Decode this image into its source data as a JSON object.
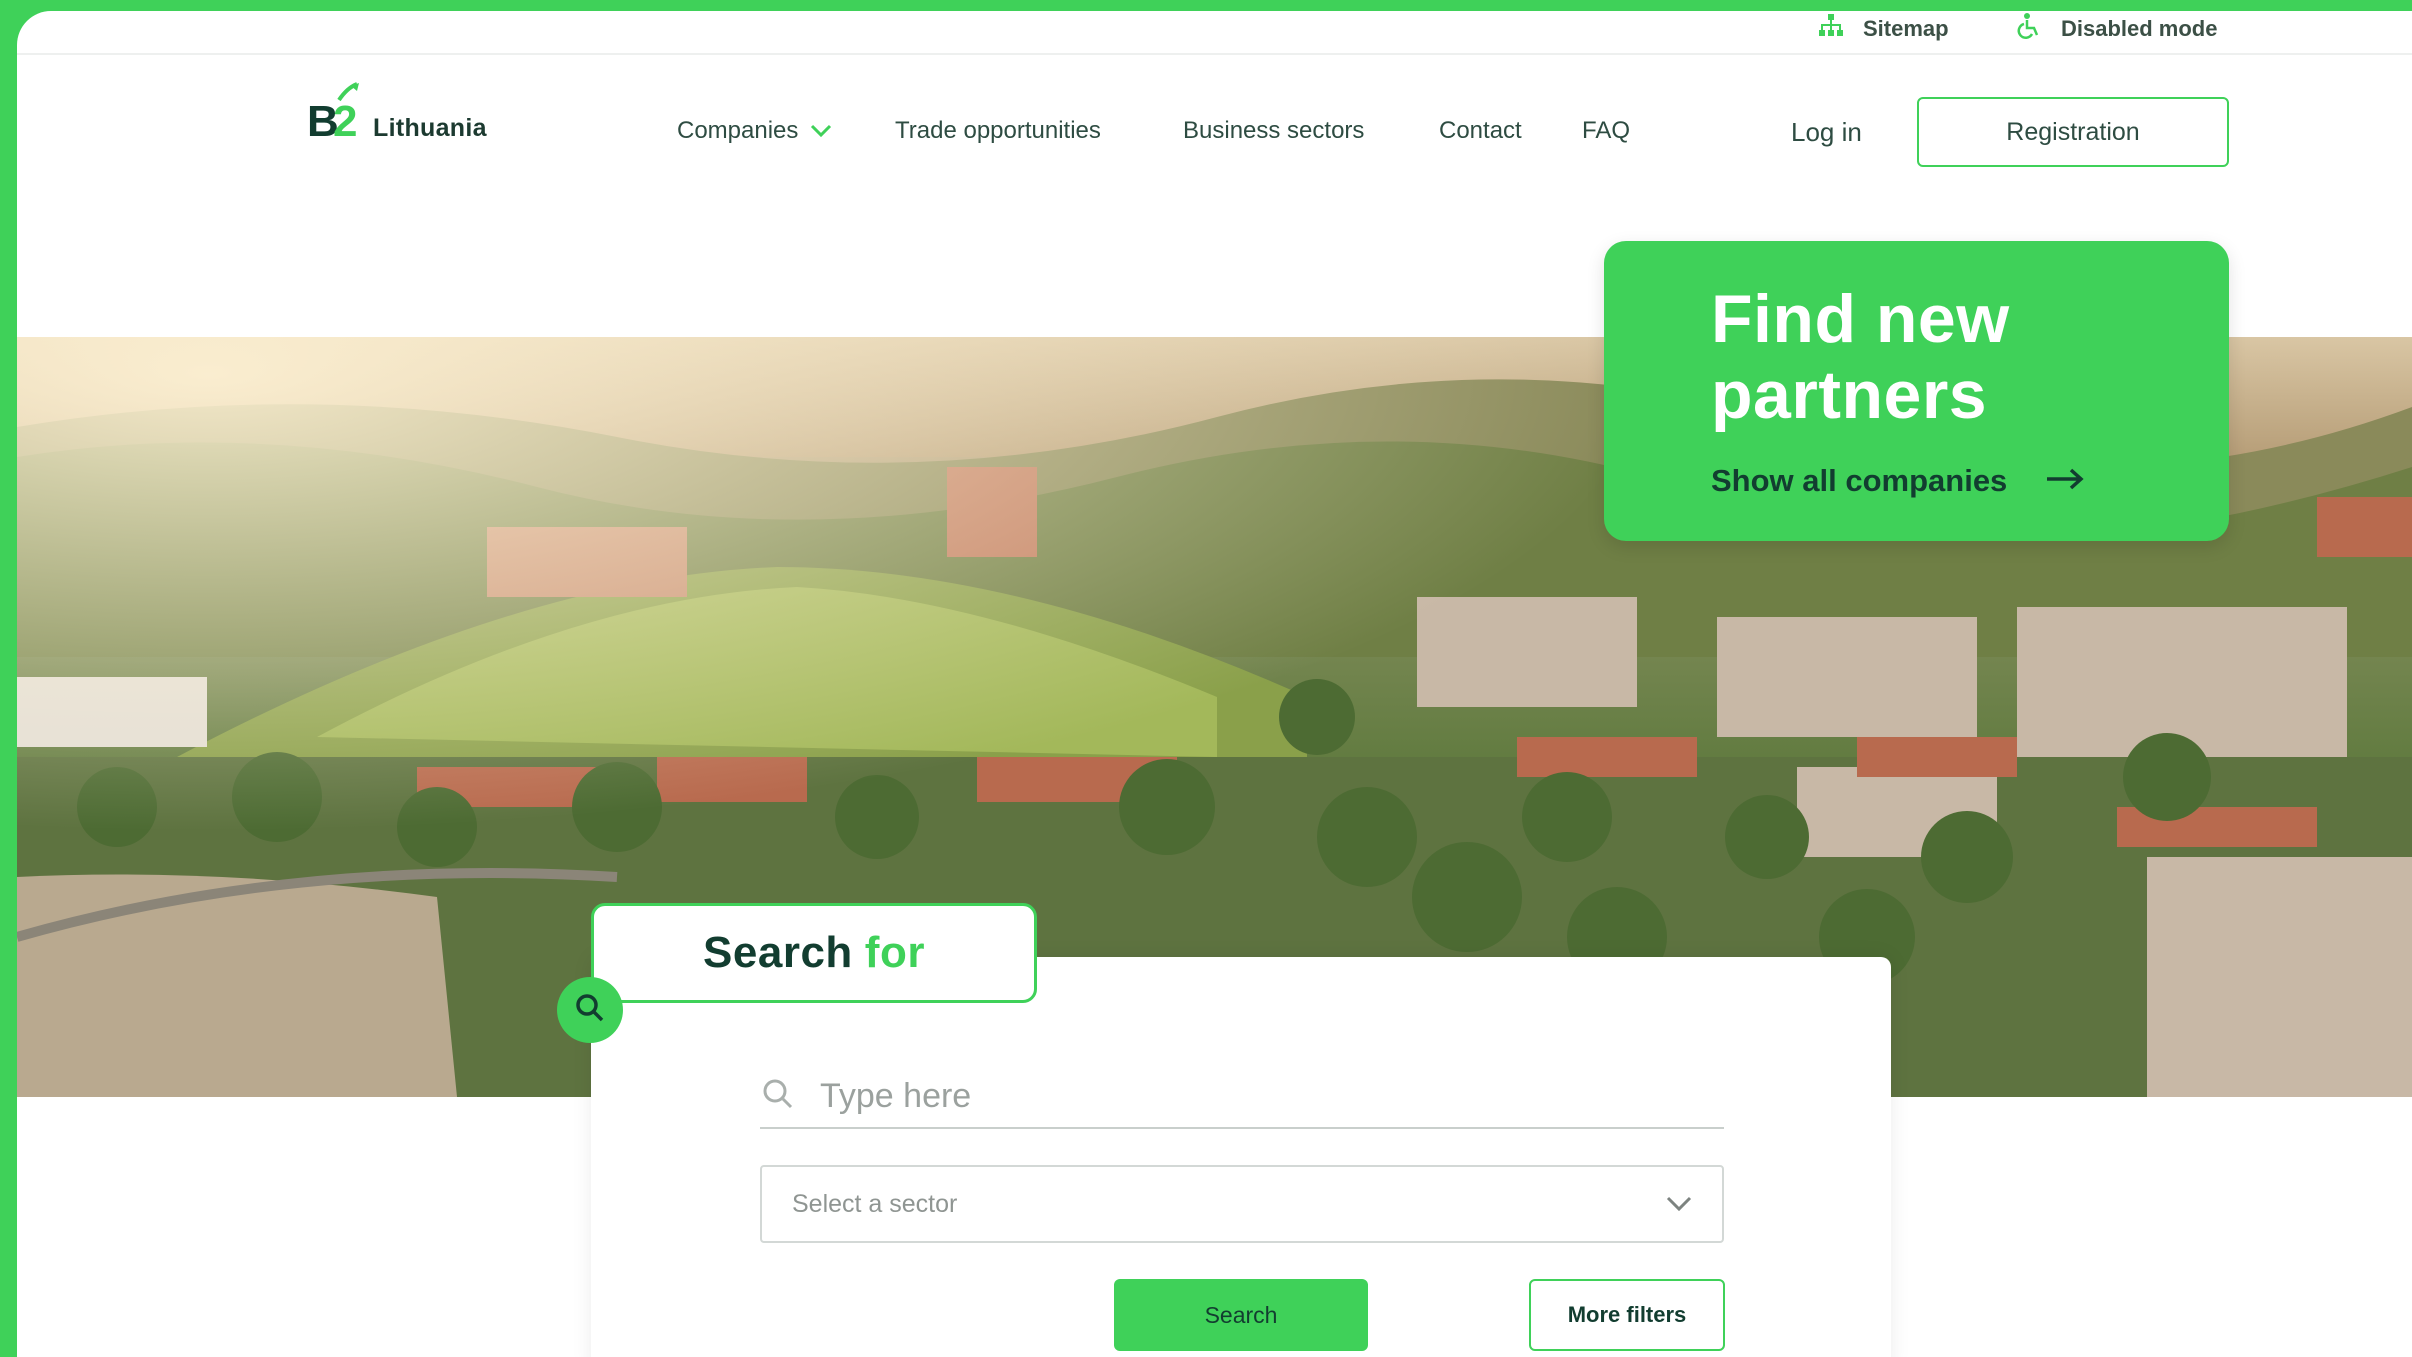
{
  "utility": {
    "sitemap": "Sitemap",
    "disabled_mode": "Disabled mode"
  },
  "logo": {
    "mark": "B2",
    "text": "Lithuania",
    "icon": "b2-lithuania-logo-icon"
  },
  "nav": {
    "items": [
      {
        "label": "Companies",
        "has_dropdown": true
      },
      {
        "label": "Trade opportunities"
      },
      {
        "label": "Business sectors"
      },
      {
        "label": "Contact"
      },
      {
        "label": "FAQ"
      }
    ],
    "login": "Log in",
    "registration": "Registration"
  },
  "promo": {
    "title_line1": "Find new",
    "title_line2": "partners",
    "link": "Show all companies",
    "link_icon": "arrow-right-icon"
  },
  "search": {
    "tab_title": "Search",
    "tab_accent": "for",
    "placeholder": "Type here",
    "sector_placeholder": "Select a sector",
    "search_button": "Search",
    "filters_button": "More filters"
  },
  "colors": {
    "brand_green": "#3fd159",
    "dark_green": "#123d30",
    "nav_text": "#2e4c42"
  }
}
